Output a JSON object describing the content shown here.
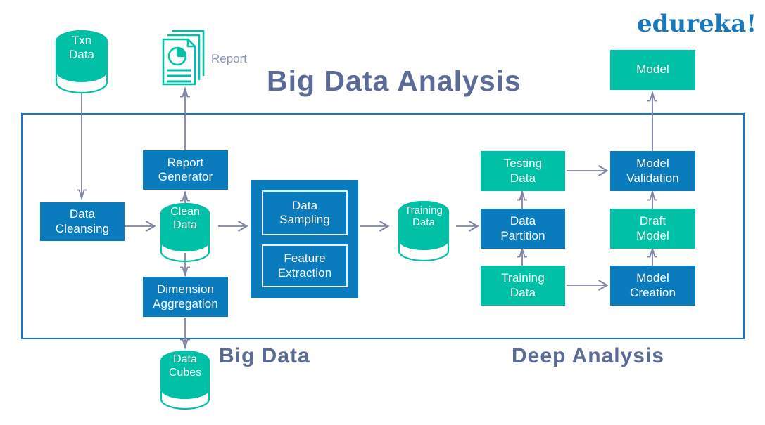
{
  "brand": {
    "logo_text": "edureka!",
    "logo_color": "#1878be"
  },
  "palette": {
    "blue": "#0a7cbd",
    "teal": "#00c0a5",
    "frame_border": "#1878c8",
    "arrow": "#7d82a6",
    "heading_text": "#5b6a96",
    "label_text": "#8e93b5",
    "node_text": "#ffffff",
    "background": "#ffffff"
  },
  "headings": {
    "title": "Big Data Analysis",
    "big_data": "Big Data",
    "deep_analysis": "Deep Analysis"
  },
  "labels": {
    "report": "Report"
  },
  "icons": {
    "report": "report-document-icon",
    "database": "database-cylinder-icon",
    "arrow": "arrow-icon"
  },
  "nodes": {
    "txn_data": {
      "label": "Txn\nData",
      "shape": "cylinder",
      "color": "teal"
    },
    "data_cleansing": {
      "label": "Data\nCleansing",
      "shape": "rect",
      "color": "blue"
    },
    "report_generator": {
      "label": "Report\nGenerator",
      "shape": "rect",
      "color": "blue"
    },
    "clean_data": {
      "label": "Clean\nData",
      "shape": "cylinder",
      "color": "teal"
    },
    "dimension_aggregation": {
      "label": "Dimension\nAggregation",
      "shape": "rect",
      "color": "blue"
    },
    "data_cubes": {
      "label": "Data\nCubes",
      "shape": "cylinder",
      "color": "teal"
    },
    "data_sampling": {
      "label": "Data\nSampling",
      "shape": "rect",
      "color": "blue"
    },
    "feature_extraction": {
      "label": "Feature\nExtraction",
      "shape": "rect",
      "color": "blue"
    },
    "training_data_cyl": {
      "label": "Training\nData",
      "shape": "cylinder",
      "color": "teal"
    },
    "testing_data": {
      "label": "Testing\nData",
      "shape": "rect",
      "color": "teal"
    },
    "data_partition": {
      "label": "Data\nPartition",
      "shape": "rect",
      "color": "blue"
    },
    "training_data_box": {
      "label": "Training\nData",
      "shape": "rect",
      "color": "teal"
    },
    "model_validation": {
      "label": "Model\nValidation",
      "shape": "rect",
      "color": "blue"
    },
    "draft_model": {
      "label": "Draft\nModel",
      "shape": "rect",
      "color": "teal"
    },
    "model_creation": {
      "label": "Model\nCreation",
      "shape": "rect",
      "color": "blue"
    },
    "model": {
      "label": "Model",
      "shape": "rect",
      "color": "teal"
    }
  }
}
